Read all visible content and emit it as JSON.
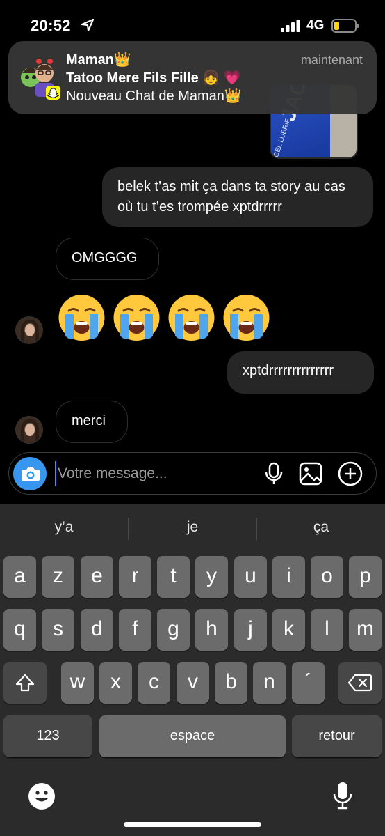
{
  "status": {
    "time": "20:52",
    "network": "4G"
  },
  "notification": {
    "app": "Snapchat",
    "title": "Maman👑",
    "time": "maintenant",
    "subtitle": "Tatoo Mere Fils Fille 👧 💗",
    "body": "Nouveau Chat de Maman👑"
  },
  "chat": {
    "messages": [
      {
        "direction": "out",
        "text": "belek t’as mit ça dans ta story au cas où tu t’es trompée xptdrrrrr"
      },
      {
        "direction": "in",
        "text": "OMGGGG"
      },
      {
        "direction": "in",
        "emoji": "😭 😭 😭 😭"
      },
      {
        "direction": "out",
        "text": "xptdrrrrrrrrrrrrrr"
      },
      {
        "direction": "in",
        "text": "merci"
      }
    ],
    "image_text": {
      "brand": "JAC",
      "sub": "GEL LUBRIF"
    }
  },
  "composer": {
    "placeholder": "Votre message..."
  },
  "keyboard": {
    "suggestions": [
      "y’a",
      "je",
      "ça"
    ],
    "row1": [
      "a",
      "z",
      "e",
      "r",
      "t",
      "y",
      "u",
      "i",
      "o",
      "p"
    ],
    "row2": [
      "q",
      "s",
      "d",
      "f",
      "g",
      "h",
      "j",
      "k",
      "l",
      "m"
    ],
    "row3": [
      "w",
      "x",
      "c",
      "v",
      "b",
      "n",
      "´"
    ],
    "numbers": "123",
    "space": "espace",
    "return": "retour"
  },
  "colors": {
    "accent": "#3797f0",
    "bubble_out": "#262626",
    "keyboard_bg": "#2b2b2b",
    "key": "#6b6b6b"
  }
}
